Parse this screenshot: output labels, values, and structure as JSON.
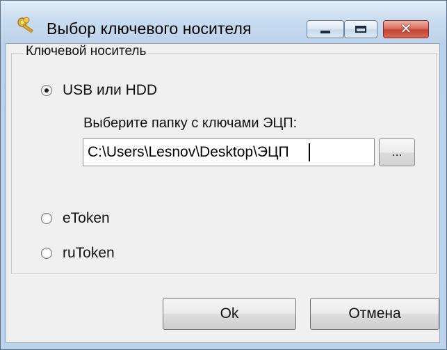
{
  "window": {
    "title": "Выбор ключевого носителя",
    "close_glyph": "✕"
  },
  "group": {
    "legend": "Ключевой носитель",
    "options": [
      {
        "label": "USB или HDD",
        "checked": true
      },
      {
        "label": "eToken",
        "checked": false
      },
      {
        "label": "ruToken",
        "checked": false
      }
    ],
    "folder_prompt": "Выберите папку с ключами ЭЦП:",
    "folder_path": "C:\\Users\\Lesnov\\Desktop\\ЭЦП",
    "browse_label": "..."
  },
  "buttons": {
    "ok_label": "Ok",
    "cancel_label": "Отмена"
  },
  "colors": {
    "titlebar": "#c9dcf0",
    "close_button": "#c4452f",
    "dialog_background": "#f0f0f0"
  },
  "icons": [
    "keys-icon",
    "minimize-icon",
    "maximize-icon",
    "close-icon"
  ]
}
